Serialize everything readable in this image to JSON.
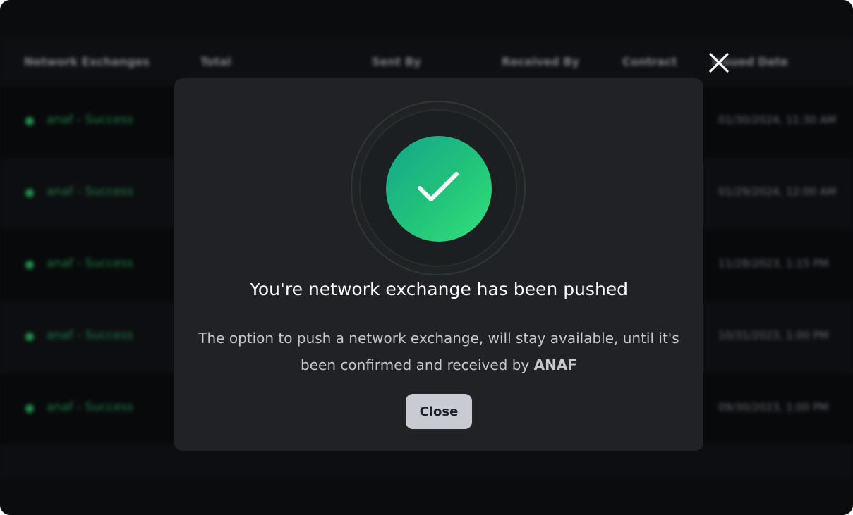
{
  "background_table": {
    "columns": [
      "Network Exchanges",
      "Total",
      "Sent By",
      "Received By",
      "Contract",
      "Issued Date"
    ],
    "rows": [
      {
        "status": "anaf - Success",
        "date": "01/30/2024, 11:30 AM"
      },
      {
        "status": "anaf - Success",
        "date": "01/29/2024, 12:00 AM"
      },
      {
        "status": "anaf - Success",
        "date": "11/28/2023, 1:15 PM"
      },
      {
        "status": "anaf - Success",
        "date": "10/31/2023, 1:00 PM"
      },
      {
        "status": "anaf - Success",
        "date": "09/30/2023, 1:00 PM"
      }
    ],
    "status_color": "#1f8f4a"
  },
  "modal": {
    "title": "You're network exchange has been pushed",
    "description_prefix": "The option to push a network exchange, will stay available, until it's been confirmed and received by ",
    "description_emphasis": "ANAF",
    "close_button": "Close",
    "icon": "checkmark-icon",
    "accent_color": "#2dd47a"
  },
  "dismiss_icon": "close-icon"
}
